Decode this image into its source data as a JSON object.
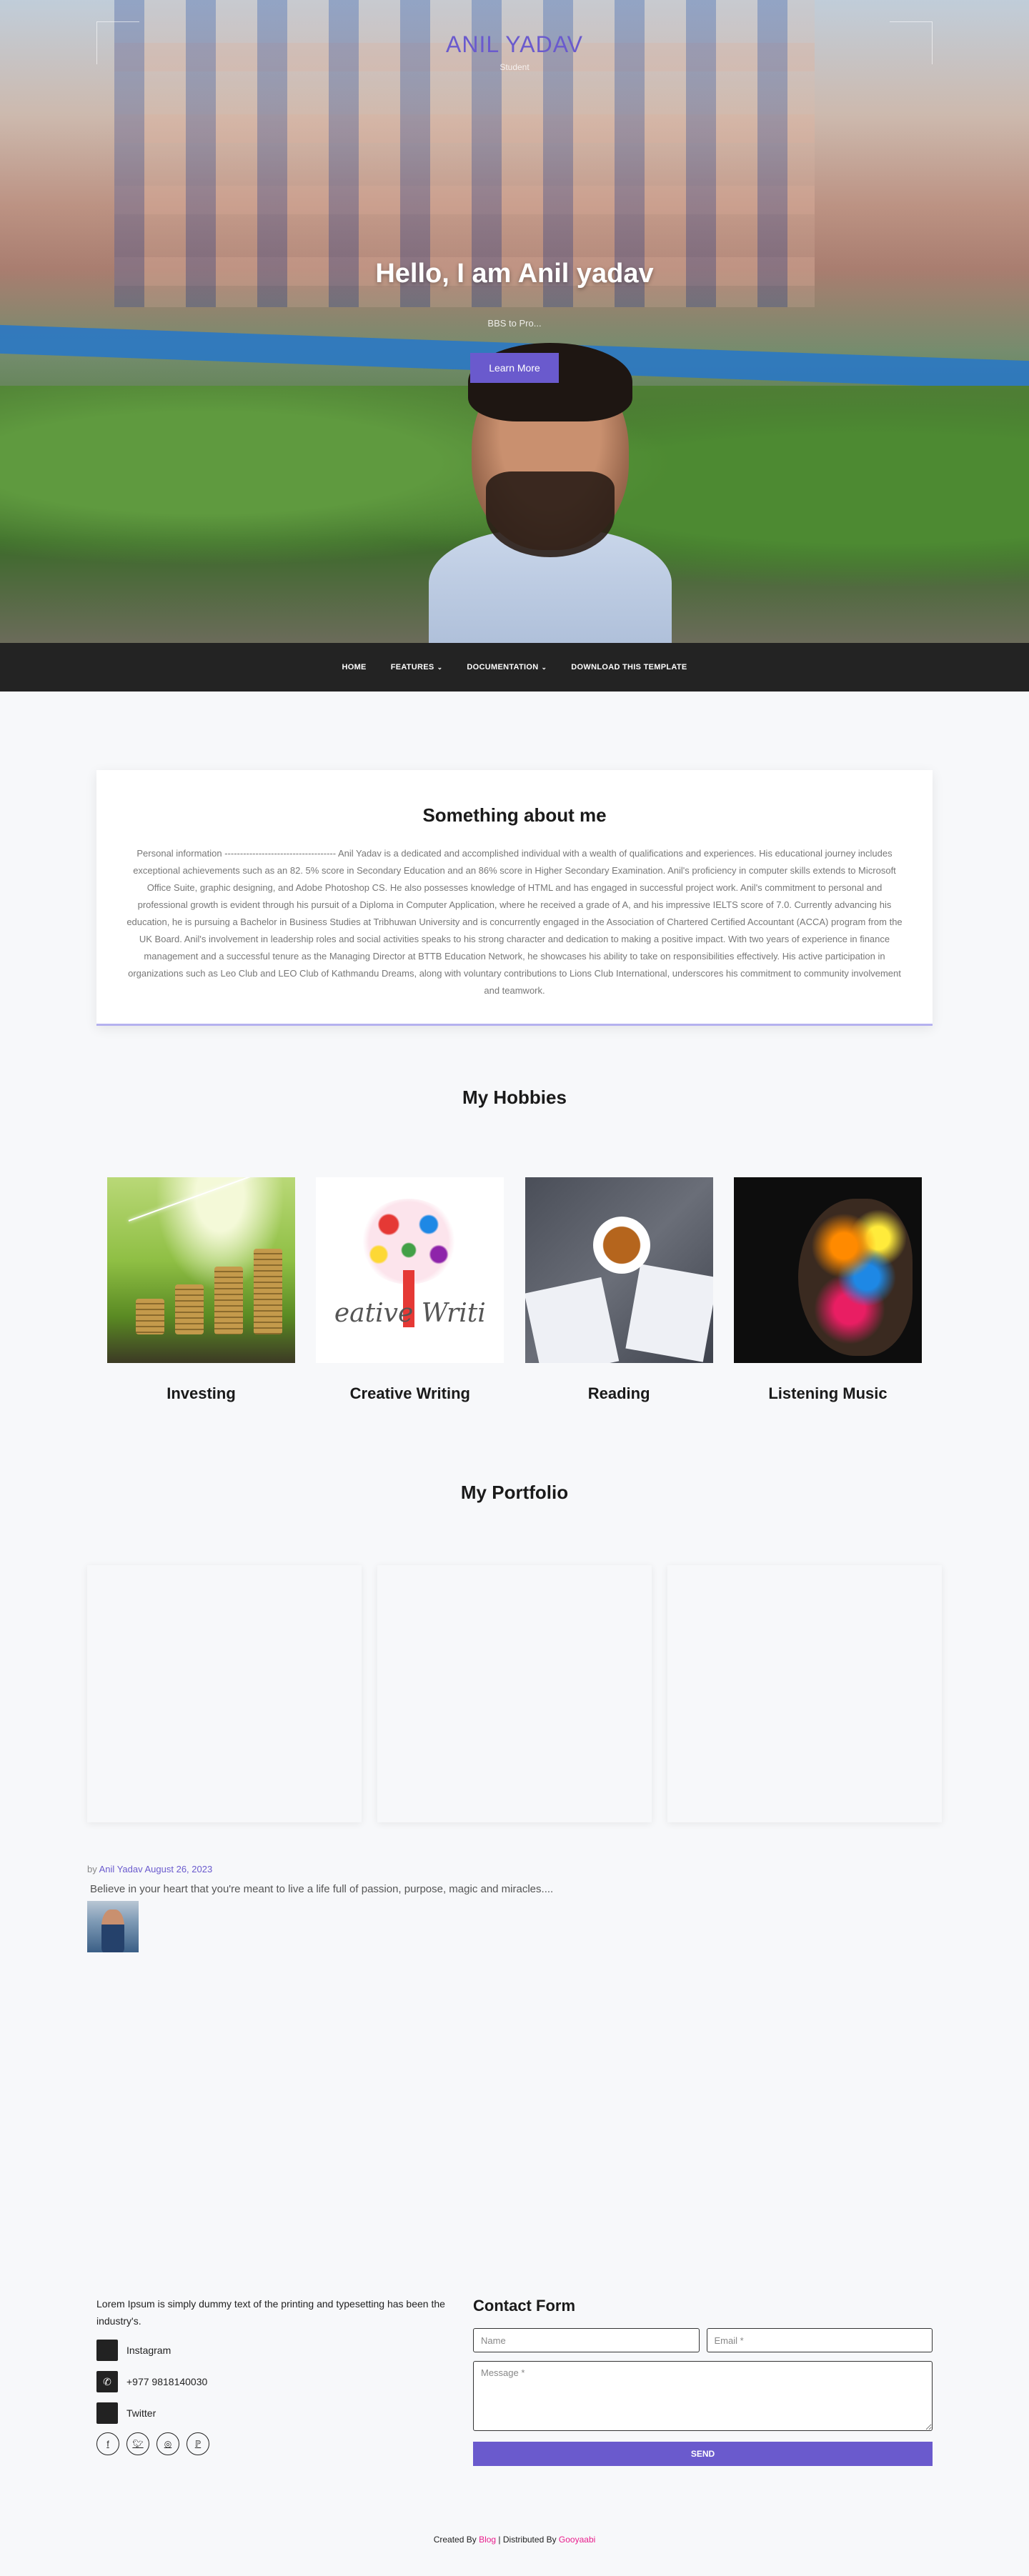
{
  "hero": {
    "brand_name": "ANIL YADAV",
    "brand_role": "Student",
    "heading": "Hello, I am Anil yadav",
    "subheading": "BBS to Pro...",
    "button_label": "Learn More"
  },
  "nav": {
    "items": [
      {
        "label": "HOME"
      },
      {
        "label": "FEATURES"
      },
      {
        "label": "DOCUMENTATION"
      },
      {
        "label": "DOWNLOAD THIS TEMPLATE"
      }
    ]
  },
  "about": {
    "title": "Something about me",
    "body": "Personal information ------------------------------------ Anil Yadav is a dedicated and accomplished individual with a wealth of qualifications and experiences. His educational journey includes exceptional achievements such as an 82. 5% score in Secondary Education and an 86% score in Higher Secondary Examination. Anil's proficiency in computer skills extends to Microsoft Office Suite, graphic designing, and Adobe Photoshop CS. He also possesses knowledge of HTML and has engaged in successful project work. Anil's commitment to personal and professional growth is evident through his pursuit of a Diploma in Computer Application, where he received a grade of A, and his impressive IELTS score of 7.0. Currently advancing his education, he is pursuing a Bachelor in Business Studies at Tribhuwan University and is concurrently engaged in the Association of Chartered Certified Accountant (ACCA) program from the UK Board. Anil's involvement in leadership roles and social activities speaks to his strong character and dedication to making a positive impact. With two years of experience in finance management and a successful tenure as the Managing Director at BTTB Education Network, he showcases his ability to take on responsibilities effectively. His active participation in organizations such as Leo Club and LEO Club of Kathmandu Dreams, along with voluntary contributions to Lions Club International, underscores his commitment to community involvement and teamwork."
  },
  "hobbies": {
    "title": "My Hobbies",
    "items": [
      {
        "label": "Investing"
      },
      {
        "label": "Creative Writing",
        "image_text": "eative  Writi"
      },
      {
        "label": "Reading"
      },
      {
        "label": "Listening Music"
      }
    ]
  },
  "portfolio": {
    "title": "My Portfolio"
  },
  "post": {
    "by": "by",
    "author": "Anil Yadav",
    "date": "August 26, 2023",
    "excerpt": "Believe in your heart that you're meant to live a life full of passion, purpose, magic and miracles...."
  },
  "footer": {
    "about_text": "Lorem Ipsum is simply dummy text of the printing and typesetting has been the industry's.",
    "contacts": [
      {
        "icon": "instagram-icon",
        "label": "Instagram"
      },
      {
        "icon": "whatsapp-icon",
        "label": "+977 9818140030"
      },
      {
        "icon": "twitter-icon",
        "label": "Twitter"
      }
    ],
    "socials": [
      "facebook-icon",
      "twitter-icon",
      "instagram-icon",
      "pinterest-icon"
    ],
    "form": {
      "title": "Contact Form",
      "name_placeholder": "Name",
      "email_placeholder": "Email *",
      "message_placeholder": "Message *",
      "send_label": "SEND"
    }
  },
  "credits": {
    "prefix": "Created By",
    "created_by": "Blog",
    "separator": " | Distributed By",
    "distributed_by": "Gooyaabi"
  },
  "colors": {
    "accent": "#6a5acd",
    "nav_bg": "#232323",
    "credit_link": "#e91e8c"
  }
}
